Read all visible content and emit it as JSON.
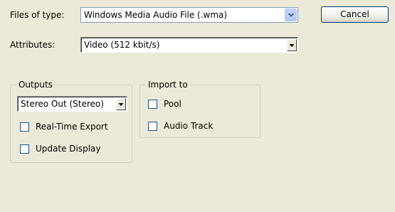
{
  "files_of_type": {
    "label": "Files of type:",
    "value": "Windows Media Audio File (.wma)"
  },
  "attributes": {
    "label": "Attributes:",
    "value": "Video (512 kbit/s)"
  },
  "cancel_label": "Cancel",
  "outputs": {
    "title": "Outputs",
    "select_value": "Stereo Out (Stereo)",
    "realtime_export": {
      "label": "Real-Time Export",
      "checked": false
    },
    "update_display": {
      "label": "Update Display",
      "checked": false
    }
  },
  "import_to": {
    "title": "Import to",
    "pool": {
      "label": "Pool",
      "checked": false
    },
    "audio_track": {
      "label": "Audio Track",
      "checked": false
    }
  },
  "icons": {
    "dropdown": "chevron-down-icon"
  }
}
